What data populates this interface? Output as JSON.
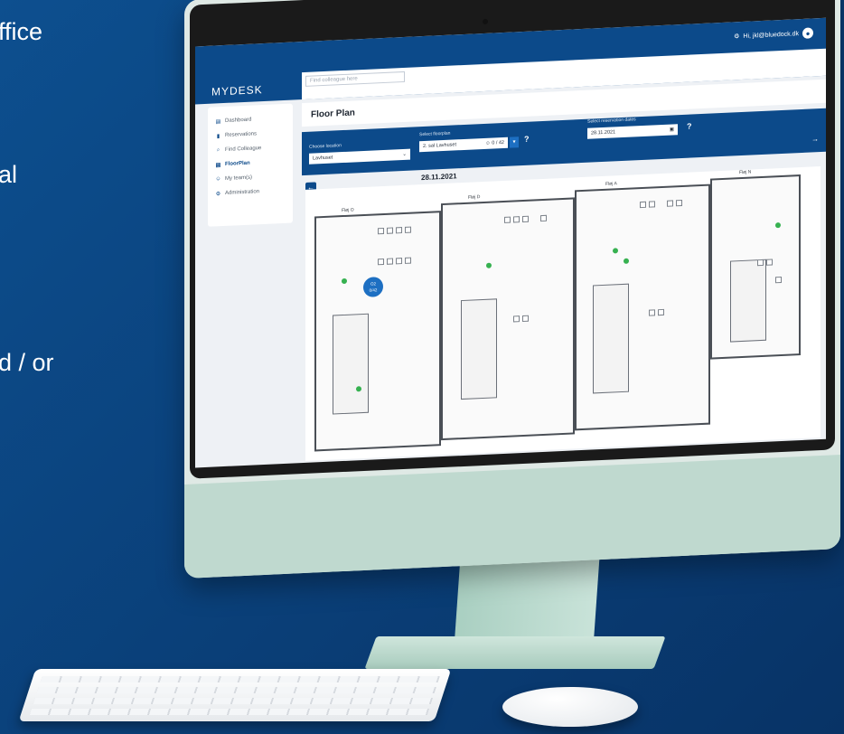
{
  "background_text": {
    "line1": "ffice",
    "line2": "al",
    "line3": "d / or"
  },
  "app": {
    "logo": "MYDESK",
    "user_label": "Hi, jkl@bluedock.dk",
    "search_placeholder": "Find colleague here",
    "page_title": "Floor Plan",
    "sidebar": [
      {
        "label": "Dashboard",
        "icon": "chart-icon"
      },
      {
        "label": "Reservations",
        "icon": "bookmark-icon"
      },
      {
        "label": "Find Colleague",
        "icon": "search-icon"
      },
      {
        "label": "FloorPlan",
        "icon": "chart-icon",
        "active": true
      },
      {
        "label": "My team(s)",
        "icon": "team-icon"
      },
      {
        "label": "Administration",
        "icon": "gear-icon"
      }
    ],
    "filters": {
      "location_label": "Choose location",
      "location_value": "Lavhuset",
      "floorplan_label": "Select floorplan",
      "floorplan_value": "2. sal Lavhuset",
      "floorplan_count": "0 / 42",
      "dates_label": "Select reservation dates",
      "dates_value": "28.11.2021",
      "help": "?"
    },
    "plan": {
      "date": "28.11.2021",
      "wing_labels": [
        "Fløj O",
        "Fløj D",
        "Fløj A",
        "Fløj N"
      ],
      "badge_name": "O2",
      "badge_count": "0/42"
    }
  },
  "colors": {
    "brand": "#0c4a8a",
    "background": "#0d4f8f",
    "monitor_body": "#bfd9cf"
  }
}
